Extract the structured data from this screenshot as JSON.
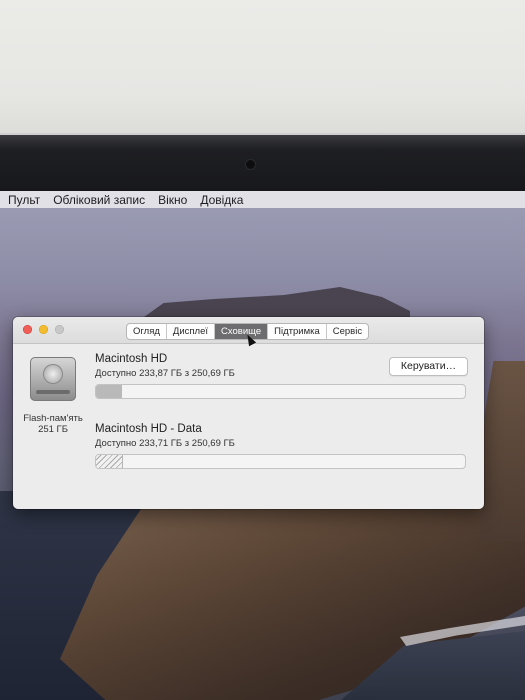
{
  "menubar": {
    "items": [
      "Пульт",
      "Обліковий запис",
      "Вікно",
      "Довідка"
    ]
  },
  "window": {
    "tabs": [
      {
        "label": "Огляд",
        "active": false
      },
      {
        "label": "Дисплеї",
        "active": false
      },
      {
        "label": "Сховище",
        "active": true
      },
      {
        "label": "Підтримка",
        "active": false
      },
      {
        "label": "Сервіс",
        "active": false
      }
    ],
    "drive": {
      "type_label": "Flash-пам'ять",
      "size_label": "251 ГБ"
    },
    "volumes": [
      {
        "name": "Macintosh HD",
        "available": "Доступно 233,87 ГБ з 250,69 ГБ",
        "used_fraction": 0.07,
        "fill_style": "solid"
      },
      {
        "name": "Macintosh HD - Data",
        "available": "Доступно 233,71 ГБ з 250,69 ГБ",
        "used_fraction": 0.07,
        "fill_style": "hatched"
      }
    ],
    "manage_button": "Керувати…"
  }
}
